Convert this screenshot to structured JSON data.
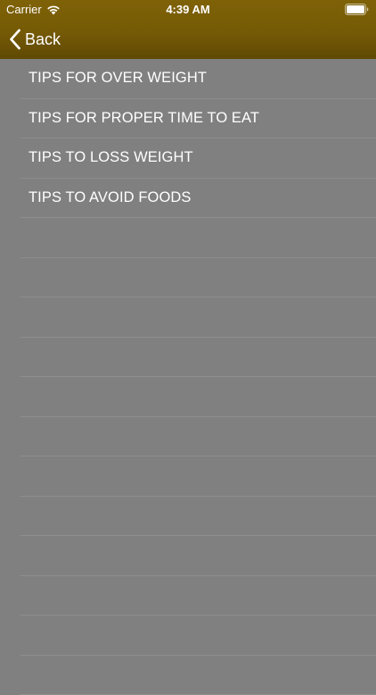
{
  "status_bar": {
    "carrier": "Carrier",
    "time": "4:39 AM",
    "wifi_icon": "wifi-icon",
    "battery_icon": "battery-icon"
  },
  "nav": {
    "back_label": "Back",
    "back_icon": "chevron-left-icon",
    "header_color": "#755a06"
  },
  "list": {
    "background": "#808080",
    "items": [
      {
        "label": "TIPS FOR OVER WEIGHT"
      },
      {
        "label": "TIPS FOR PROPER TIME TO EAT"
      },
      {
        "label": "TIPS TO LOSS WEIGHT"
      },
      {
        "label": "TIPS TO AVOID FOODS"
      }
    ]
  }
}
